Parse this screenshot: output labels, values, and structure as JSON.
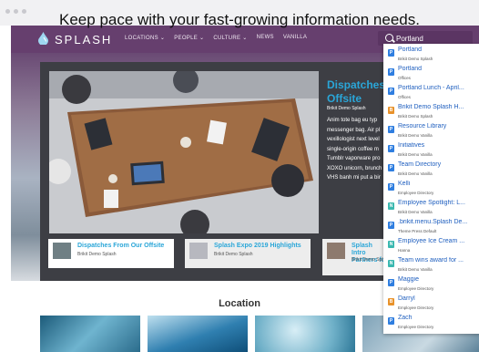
{
  "caption": "Keep pace with your fast-growing information needs.",
  "brand": {
    "logo_text": "SPLASH",
    "color": "#663f6e",
    "accent": "#2aa6d8"
  },
  "nav": {
    "items": [
      "LOCATIONS ⌄",
      "PEOPLE ⌄",
      "CULTURE ⌄",
      "NEWS",
      "VANILLA"
    ]
  },
  "search": {
    "value": "Portland",
    "icon": "search-icon"
  },
  "hero": {
    "title": "Dispatches F Offsite",
    "author": "Brikit Demo Splash",
    "body_lines": [
      "Anim tote bag eu typ",
      "messenger bag. Air pl",
      "vexillologist next level",
      "single-origin coffee m",
      "Tumblr vaporware pro",
      "XOXO unicorn, brunch",
      "VHS banh mi put a bir"
    ]
  },
  "cards": [
    {
      "title": "Dispatches From Our Offsite",
      "author": "Brikit Demo Splash"
    },
    {
      "title": "Splash Expo 2019 Highlights",
      "author": "Brikit Demo Splash"
    },
    {
      "title": "Splash Intro Partners for",
      "author": "Brikit Demo Splas"
    }
  ],
  "section": {
    "title": "Location"
  },
  "dropdown": [
    {
      "icon": "P",
      "icon_color": "#2f7ee0",
      "title": "Portland",
      "sub": "Brikit Demo Splash"
    },
    {
      "icon": "P",
      "icon_color": "#2f7ee0",
      "title": "Portland",
      "sub": "Offices"
    },
    {
      "icon": "P",
      "icon_color": "#2f7ee0",
      "title": "Portland Lunch - April...",
      "sub": "Offices"
    },
    {
      "icon": "B",
      "icon_color": "#e8922a",
      "title": "Brikit Demo Splash H...",
      "sub": "Brikit Demo Splash"
    },
    {
      "icon": "P",
      "icon_color": "#2f7ee0",
      "title": "Resource Library",
      "sub": "Brikit Demo Vanilla"
    },
    {
      "icon": "P",
      "icon_color": "#2f7ee0",
      "title": "Initiatives",
      "sub": "Brikit Demo Vanilla"
    },
    {
      "icon": "P",
      "icon_color": "#2f7ee0",
      "title": "Team Directory",
      "sub": "Brikit Demo Vanilla"
    },
    {
      "icon": "P",
      "icon_color": "#2f7ee0",
      "title": "Kelli",
      "sub": "Employee Directory"
    },
    {
      "icon": "N",
      "icon_color": "#3bb8b0",
      "title": "Employee Spotlight: L...",
      "sub": "Brikit Demo Vanilla"
    },
    {
      "icon": "P",
      "icon_color": "#2f7ee0",
      "title": ".brikit.menu.Splash De...",
      "sub": "Theme Press Default"
    },
    {
      "icon": "N",
      "icon_color": "#3bb8b0",
      "title": "Employee Ice Cream ...",
      "sub": "Hanna"
    },
    {
      "icon": "N",
      "icon_color": "#3bb8b0",
      "title": "Team wins award for ...",
      "sub": "Brikit Demo Vanilla"
    },
    {
      "icon": "P",
      "icon_color": "#2f7ee0",
      "title": "Maggie",
      "sub": "Employee Directory"
    },
    {
      "icon": "B",
      "icon_color": "#e8922a",
      "title": "Darryl",
      "sub": "Employee Directory"
    },
    {
      "icon": "P",
      "icon_color": "#2f7ee0",
      "title": "Zach",
      "sub": "Employee Directory"
    }
  ]
}
